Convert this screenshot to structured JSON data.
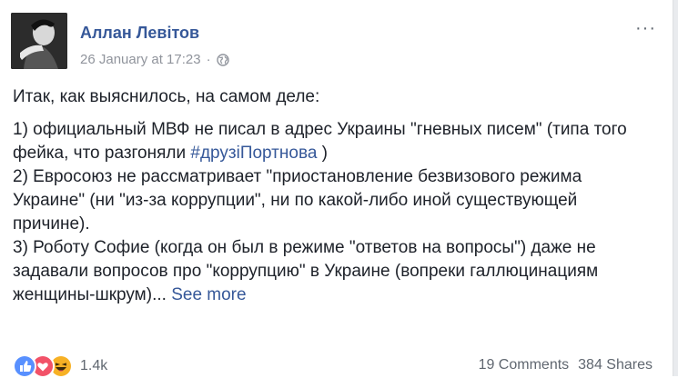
{
  "post": {
    "author": "Аллан Левітов",
    "timestamp": "26 January at 17:23",
    "separator": "·",
    "audience_icon": "globe-icon",
    "options_label": "···",
    "intro": "Итак, как выяснилось, на самом деле:",
    "item1_text": "1) официальный МВФ не писал в адрес Украины \"гневных писем\" (типа того фейка, что разгоняли ",
    "item1_hashtag": "#друзіПортнова",
    "item1_end": " )",
    "item2_text": "2) Евросоюз не рассматривает \"приостановление безвизового режима Украине\" (ни \"из-за коррупции\", ни по какой-либо иной существующей причине).",
    "item3_text": "3) Роботу Софие (когда он был в режиме \"ответов на вопросы\") даже не задавали вопросов про \"коррупцию\" в Украине (вопреки галлюцинациям женщины-шкрум)... ",
    "see_more": "See more"
  },
  "footer": {
    "reaction_icons": [
      "like-icon",
      "love-icon",
      "haha-icon"
    ],
    "reaction_count": "1.4k",
    "comments": "19 Comments",
    "shares": "384 Shares"
  },
  "colors": {
    "link": "#365899",
    "meta": "#90949c",
    "text": "#1d2129",
    "like": "#5890ff",
    "love": "#f25268",
    "haha": "#f7b125"
  }
}
